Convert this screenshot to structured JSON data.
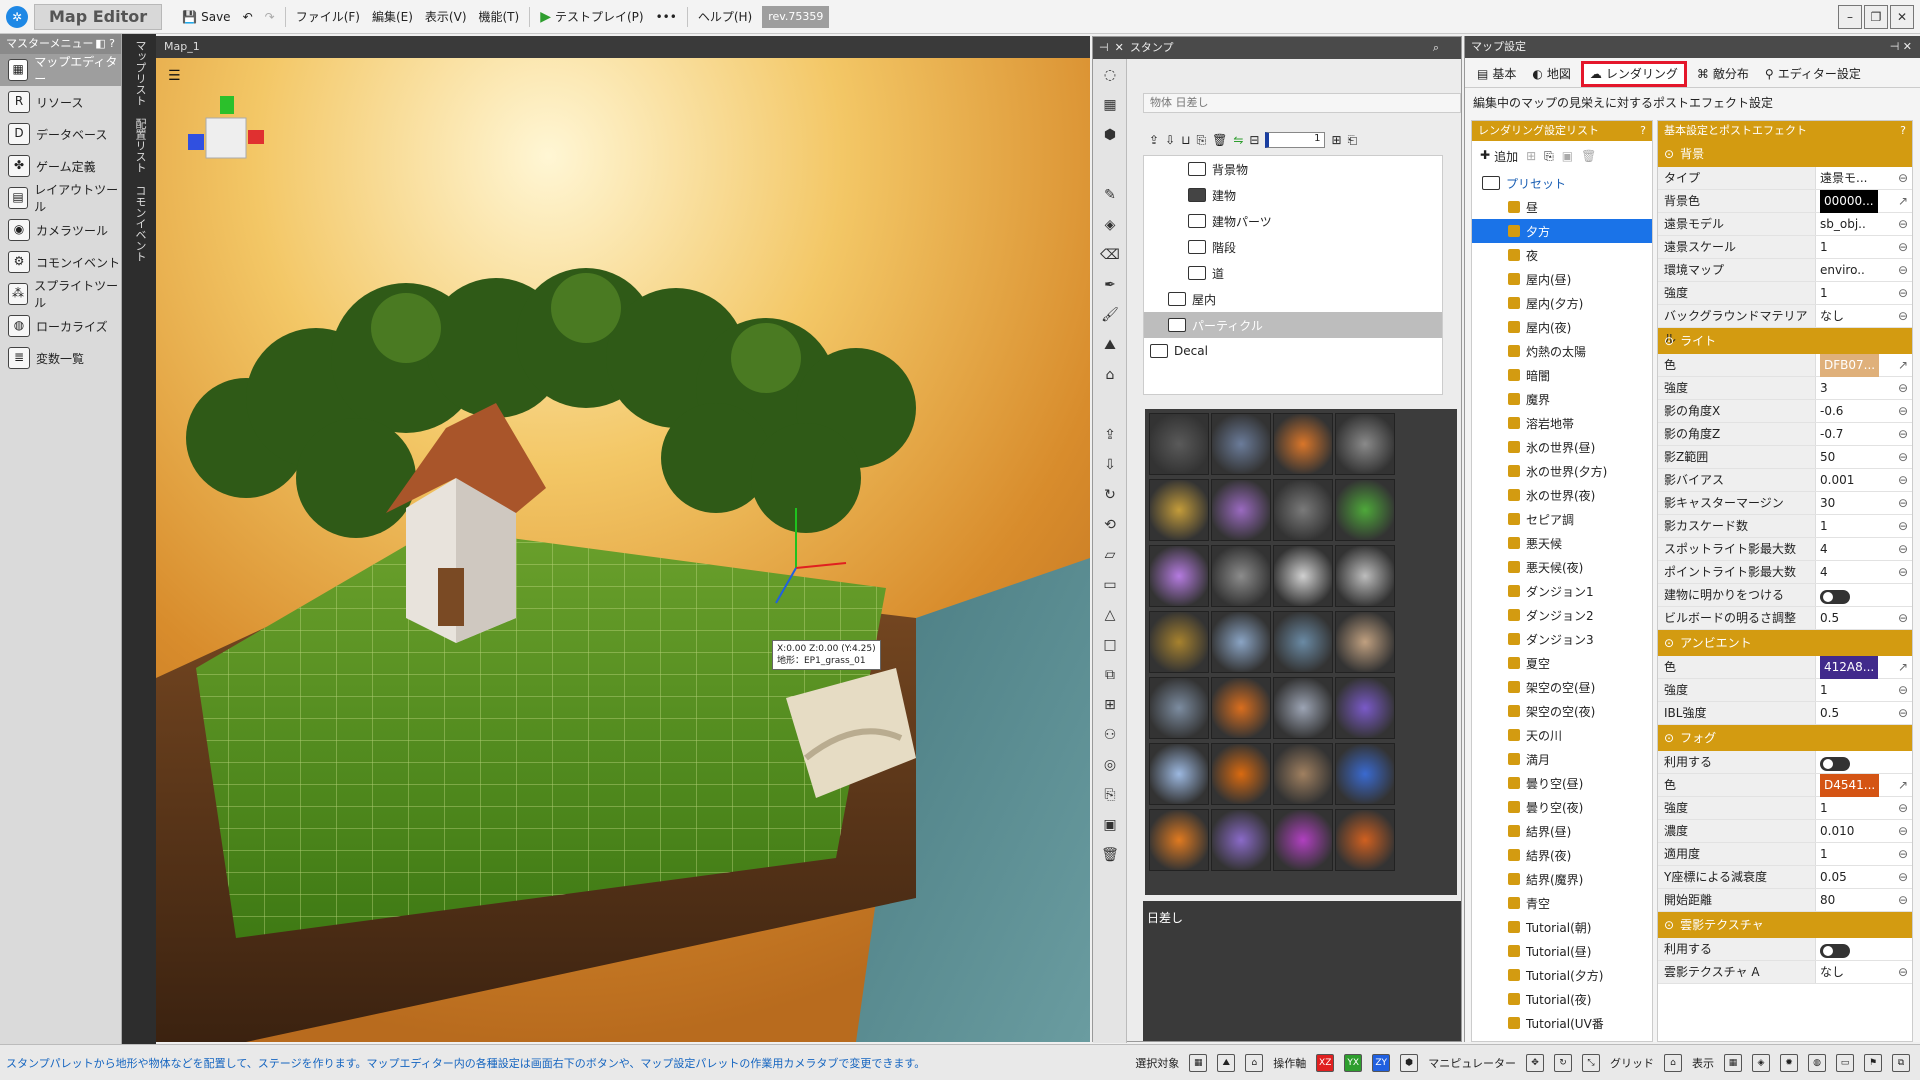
{
  "topbar": {
    "app_title": "Map Editor",
    "save_label": "Save",
    "menus": [
      "ファイル(F)",
      "編集(E)",
      "表示(V)",
      "機能(T)"
    ],
    "test_play": "テストプレイ(P)",
    "more": "•••",
    "help": "ヘルプ(H)",
    "revision": "rev.75359"
  },
  "leftmenu": {
    "header": "マスターメニュー",
    "items": [
      {
        "label": "マップエディター",
        "icon": "map-icon"
      },
      {
        "label": "リソース",
        "icon": "resource-icon"
      },
      {
        "label": "データベース",
        "icon": "database-icon"
      },
      {
        "label": "ゲーム定義",
        "icon": "game-icon"
      },
      {
        "label": "レイアウトツール",
        "icon": "layout-icon"
      },
      {
        "label": "カメラツール",
        "icon": "camera-icon"
      },
      {
        "label": "コモンイベント",
        "icon": "event-icon"
      },
      {
        "label": "スプライトツール",
        "icon": "sprite-icon"
      },
      {
        "label": "ローカライズ",
        "icon": "globe-icon"
      },
      {
        "label": "変数一覧",
        "icon": "variables-icon"
      }
    ],
    "vertical_tabs": [
      "マップリスト",
      "配置リスト",
      "コモンイベント"
    ]
  },
  "viewport": {
    "tab": "Map_1",
    "coord_label_line1": "X:0.00 Z:0.00 (Y:4.25)",
    "coord_label_line2": "地形：EP1_grass_01"
  },
  "stamp": {
    "title": "スタンプ",
    "selection": "物体 日差し",
    "layer_value": "1",
    "tree": [
      {
        "label": "背景物",
        "indent": 2,
        "filled": false
      },
      {
        "label": "建物",
        "indent": 2,
        "filled": true
      },
      {
        "label": "建物パーツ",
        "indent": 2,
        "filled": false
      },
      {
        "label": "階段",
        "indent": 2,
        "filled": false
      },
      {
        "label": "道",
        "indent": 2,
        "filled": false
      },
      {
        "label": "屋内",
        "indent": 1,
        "filled": false
      },
      {
        "label": "パーティクル",
        "indent": 1,
        "filled": false,
        "selected": true
      },
      {
        "label": "Decal",
        "indent": 0,
        "filled": false
      }
    ],
    "footer": "日差し"
  },
  "mapset": {
    "title": "マップ設定",
    "tabs": [
      "基本",
      "地図",
      "レンダリング",
      "敵分布",
      "エディター設定"
    ],
    "active_tab": "レンダリング",
    "description": "編集中のマップの見栄えに対するポストエフェクト設定",
    "list_header": "レンダリング設定リスト",
    "add_label": "追加",
    "preset_label": "プリセット",
    "presets": [
      "昼",
      "夕方",
      "夜",
      "屋内(昼)",
      "屋内(夕方)",
      "屋内(夜)",
      "灼熱の太陽",
      "暗闇",
      "魔界",
      "溶岩地帯",
      "氷の世界(昼)",
      "氷の世界(夕方)",
      "氷の世界(夜)",
      "セピア調",
      "悪天候",
      "悪天候(夜)",
      "ダンジョン1",
      "ダンジョン2",
      "ダンジョン3",
      "夏空",
      "架空の空(昼)",
      "架空の空(夜)",
      "天の川",
      "満月",
      "曇り空(昼)",
      "曇り空(夜)",
      "結界(昼)",
      "結界(夜)",
      "結界(魔界)",
      "青空",
      "Tutorial(朝)",
      "Tutorial(昼)",
      "Tutorial(夕方)",
      "Tutorial(夜)",
      "Tutorial(UV番"
    ],
    "selected_preset": "夕方",
    "props_header": "基本設定とポストエフェクト",
    "sections": [
      {
        "title": "背景",
        "rows": [
          {
            "label": "タイプ",
            "value": "遠景モ..."
          },
          {
            "label": "背景色",
            "value": "00000...",
            "swatch": "#000000"
          },
          {
            "label": "遠景モデル",
            "value": "sb_obj.."
          },
          {
            "label": "遠景スケール",
            "value": "1"
          },
          {
            "label": "環境マップ",
            "value": "enviro.."
          },
          {
            "label": "強度",
            "value": "1"
          },
          {
            "label": "バックグラウンドマテリアル",
            "value": "なし"
          }
        ]
      },
      {
        "title": "ライト",
        "rows": [
          {
            "label": "色",
            "value": "DFB07...",
            "swatch": "#dfb07a"
          },
          {
            "label": "強度",
            "value": "3"
          },
          {
            "label": "影の角度X",
            "value": "-0.6"
          },
          {
            "label": "影の角度Z",
            "value": "-0.7"
          },
          {
            "label": "影Z範囲",
            "value": "50"
          },
          {
            "label": "影バイアス",
            "value": "0.001"
          },
          {
            "label": "影キャスターマージン",
            "value": "30"
          },
          {
            "label": "影カスケード数",
            "value": "1"
          },
          {
            "label": "スポットライト影最大数",
            "value": "4"
          },
          {
            "label": "ポイントライト影最大数",
            "value": "4"
          },
          {
            "label": "建物に明かりをつける",
            "value": "",
            "toggle": true
          },
          {
            "label": "ビルボードの明るさ調整",
            "value": "0.5"
          }
        ]
      },
      {
        "title": "アンビエント",
        "rows": [
          {
            "label": "色",
            "value": "412A8...",
            "swatch": "#412a8c"
          },
          {
            "label": "強度",
            "value": "1"
          },
          {
            "label": "IBL強度",
            "value": "0.5"
          }
        ]
      },
      {
        "title": "フォグ",
        "rows": [
          {
            "label": "利用する",
            "value": "",
            "toggle": true
          },
          {
            "label": "色",
            "value": "D4541...",
            "swatch": "#d45414"
          },
          {
            "label": "強度",
            "value": "1"
          },
          {
            "label": "濃度",
            "value": "0.010"
          },
          {
            "label": "適用度",
            "value": "1"
          },
          {
            "label": "Y座標による減衰度",
            "value": "0.05"
          },
          {
            "label": "開始距離",
            "value": "80"
          }
        ]
      },
      {
        "title": "雲影テクスチャ",
        "rows": [
          {
            "label": "利用する",
            "value": "",
            "toggle": true
          },
          {
            "label": "雲影テクスチャ A",
            "value": "なし"
          }
        ]
      }
    ]
  },
  "status": {
    "message": "スタンプパレットから地形や物体などを配置して、ステージを作ります。マップエディター内の各種設定は画面右下のボタンや、マップ設定パレットの作業用カメラタブで変更できます。",
    "selection_target": "選択対象",
    "axis": "操作軸",
    "manipulator": "マニピュレーター",
    "grid": "グリッド",
    "display": "表示"
  },
  "colors": {
    "accent": "#d39b11",
    "selection": "#1a73e8",
    "active_tab_border": "#e4172b"
  }
}
